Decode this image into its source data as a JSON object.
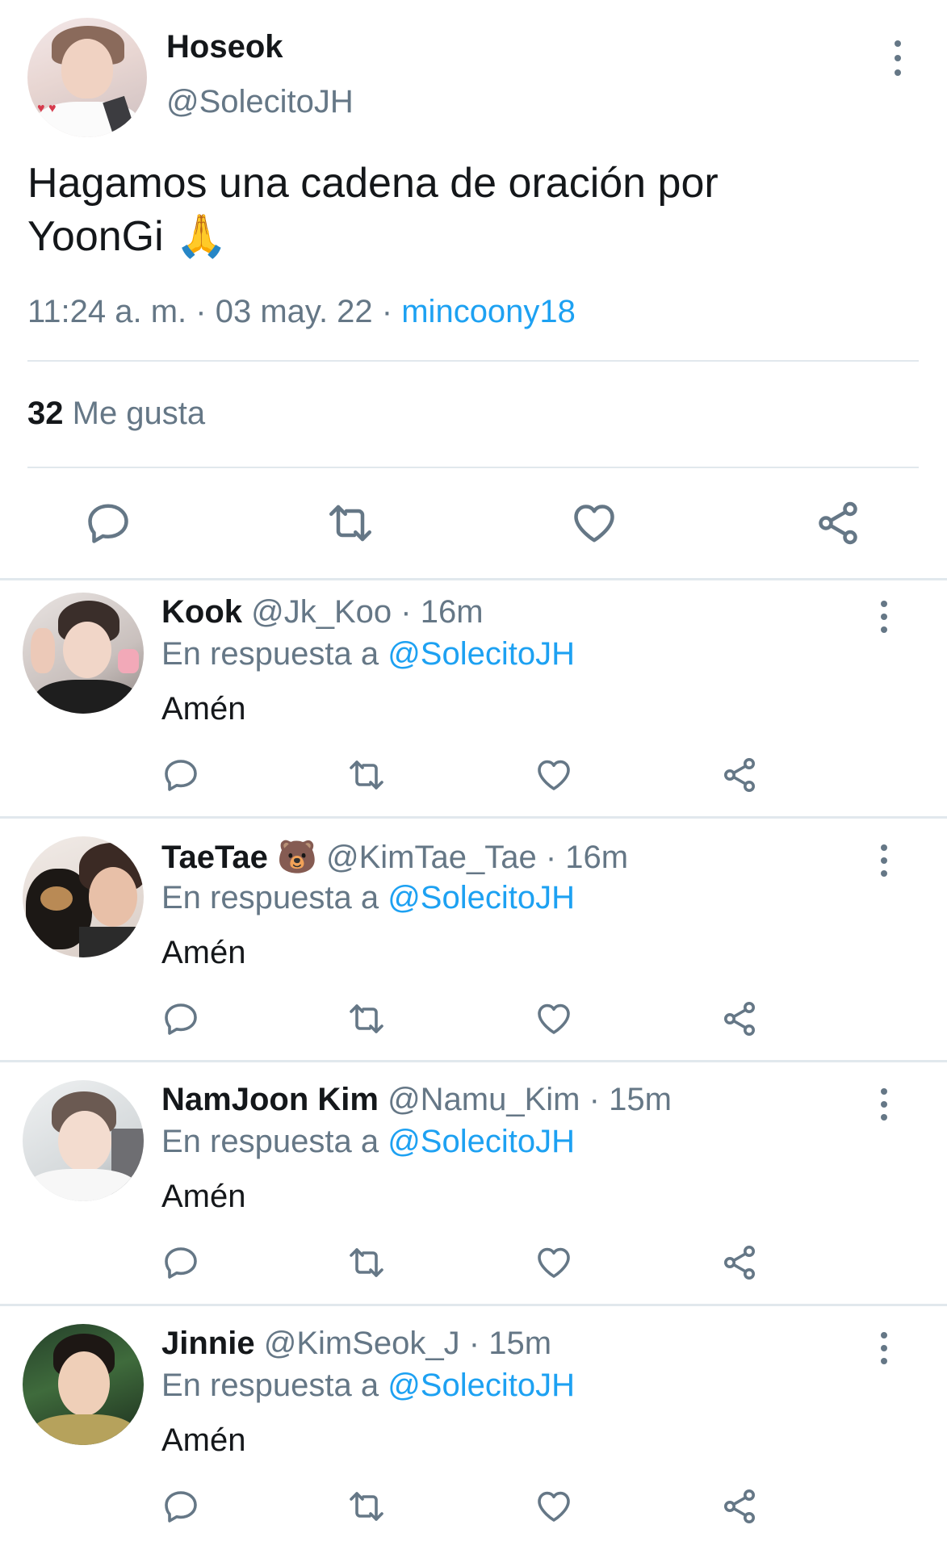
{
  "main_tweet": {
    "display_name": "Hoseok",
    "handle": "@SolecitoJH",
    "text_line1": "Hagamos una cadena de oración por",
    "text_line2": "YoonGi",
    "emoji": "🙏",
    "time": "11:24 a. m.",
    "date": "03 may. 22",
    "source": "mincoony18",
    "separator": "·",
    "likes_count": "32",
    "likes_label": "Me gusta"
  },
  "replies": [
    {
      "display_name": "Kook",
      "emoji": "",
      "handle": "@Jk_Koo",
      "age": "16m",
      "reply_prefix": "En respuesta a",
      "reply_to": "@SolecitoJH",
      "text": "Amén"
    },
    {
      "display_name": "TaeTae",
      "emoji": "🐻",
      "handle": "@KimTae_Tae",
      "age": "16m",
      "reply_prefix": "En respuesta a",
      "reply_to": "@SolecitoJH",
      "text": "Amén"
    },
    {
      "display_name": "NamJoon Kim",
      "emoji": "",
      "handle": "@Namu_Kim",
      "age": "15m",
      "reply_prefix": "En respuesta a",
      "reply_to": "@SolecitoJH",
      "text": "Amén"
    },
    {
      "display_name": "Jinnie",
      "emoji": "",
      "handle": "@KimSeok_J",
      "age": "15m",
      "reply_prefix": "En respuesta a",
      "reply_to": "@SolecitoJH",
      "text": "Amén"
    }
  ],
  "icons": {
    "reply": "reply-icon",
    "retweet": "retweet-icon",
    "like": "heart-icon",
    "share": "share-icon",
    "more": "more-vertical-icon"
  },
  "colors": {
    "link": "#1da1f2",
    "secondary_text": "#657786",
    "primary_text": "#14171a",
    "divider": "#e1e8ed"
  }
}
